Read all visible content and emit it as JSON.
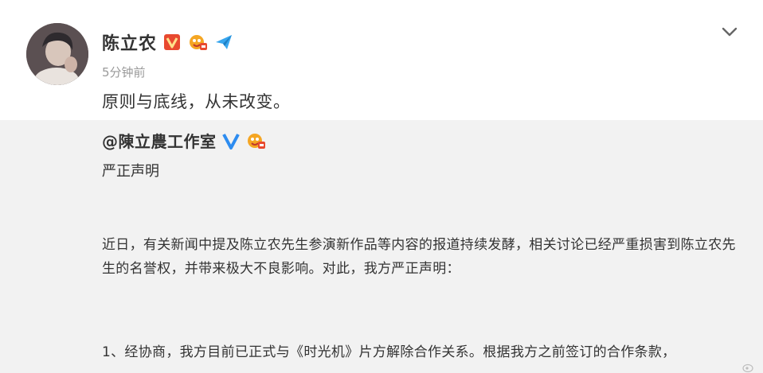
{
  "post": {
    "author": "陈立农",
    "timestamp": "5分钟前",
    "text": "原则与底线，从未改变。"
  },
  "badges": {
    "verified_icon": "red-v-badge-icon",
    "fan_icon": "fan-club-badge-icon",
    "vip_icon": "paper-plane-badge-icon"
  },
  "menu": {
    "expand_icon": "chevron-down-icon"
  },
  "repost": {
    "author": "@陳立農工作室",
    "heading": "严正声明",
    "paragraph_1": "近日，有关新闻中提及陈立农先生参演新作品等内容的报道持续发酵，相关讨论已经严重损害到陈立农先生的名誉权，并带来极大不良影响。对此，我方严正声明：",
    "paragraph_2": "1、经协商，我方目前已正式与《时光机》片方解除合作关系。根据我方之前签订的合作条款，"
  },
  "colors": {
    "repost_bg": "#f2f2f2",
    "timestamp": "#9a9a9a",
    "verified_red": "#e8492f",
    "verified_blue": "#2d8cf0",
    "vip_blue": "#38a6ee"
  }
}
